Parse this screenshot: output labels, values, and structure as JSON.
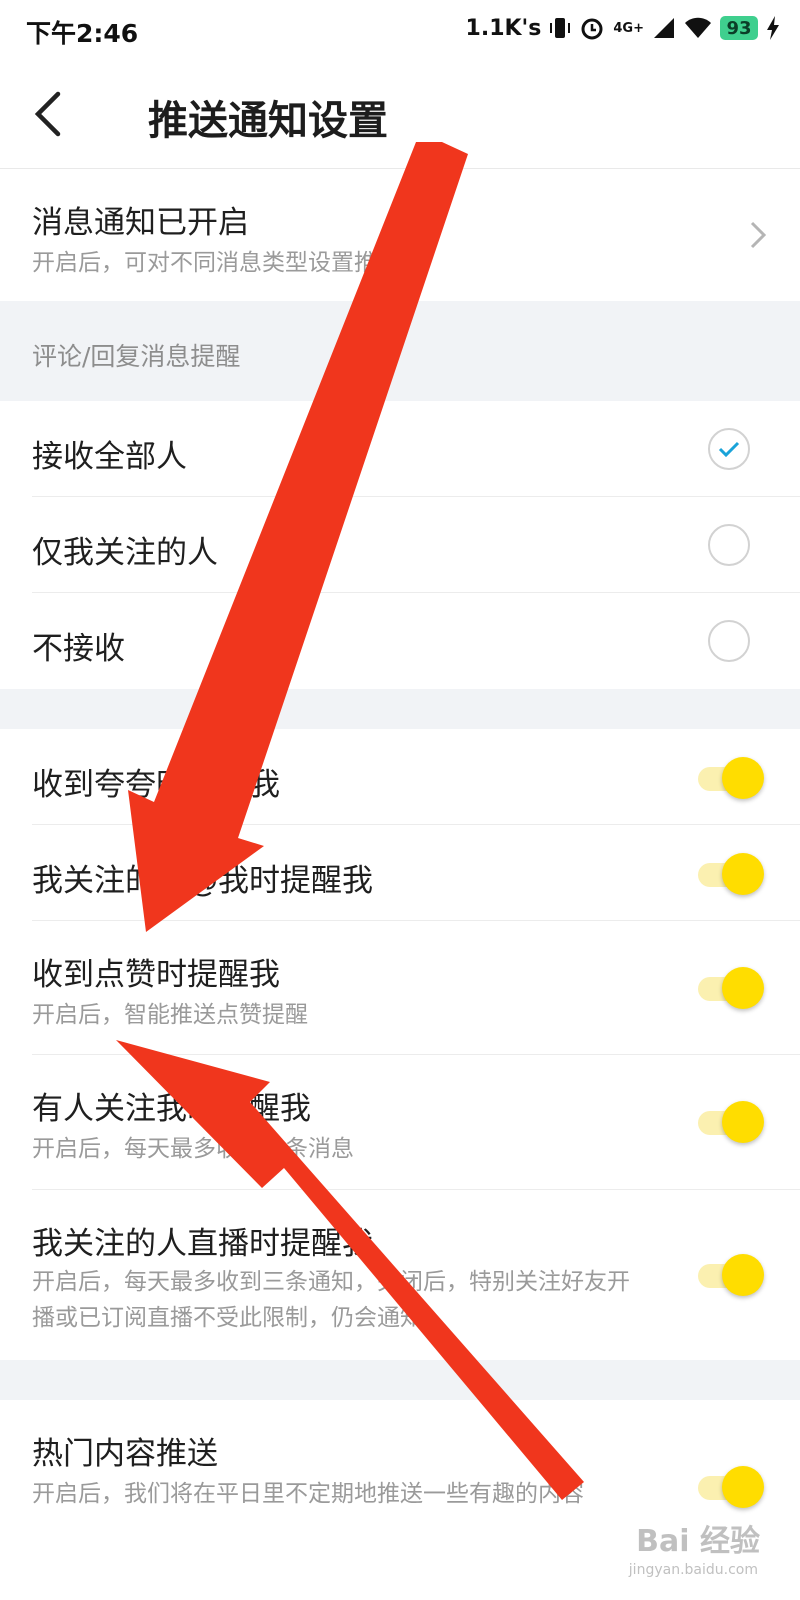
{
  "status_bar": {
    "time": "下午2:46",
    "net_speed": "1.1K's",
    "network": "4G+",
    "battery": "93",
    "icons": [
      "vibrate-icon",
      "alarm-icon",
      "signal-icon",
      "wifi-icon",
      "battery-icon",
      "charging-icon"
    ]
  },
  "header": {
    "title": "推送通知设置",
    "back_icon": "back-arrow-icon"
  },
  "notify_row": {
    "title": "消息通知已开启",
    "desc": "开启后，可对不同消息类型设置推送"
  },
  "comment_section": {
    "label": "评论/回复消息提醒",
    "options": [
      {
        "label": "接收全部人",
        "checked": true
      },
      {
        "label": "仅我关注的人",
        "checked": false
      },
      {
        "label": "不接收",
        "checked": false
      }
    ]
  },
  "toggle_rows": [
    {
      "title": "收到夸夸时提醒我",
      "desc": "",
      "on": true
    },
    {
      "title": "我关注的人@我时提醒我",
      "desc": "",
      "on": true
    },
    {
      "title": "收到点赞时提醒我",
      "desc": "开启后，智能推送点赞提醒",
      "on": true
    },
    {
      "title": "有人关注我时提醒我",
      "desc": "开启后，每天最多收到三条消息",
      "on": true
    },
    {
      "title": "我关注的人直播时提醒我",
      "desc": "开启后，每天最多收到三条通知，关闭后，特别关注好友开播或已订阅直播不受此限制，仍会通知",
      "on": true
    }
  ],
  "hot_row": {
    "title": "热门内容推送",
    "desc": "开启后，我们将在平日里不定期地推送一些有趣的内容",
    "on": true
  },
  "watermark": {
    "text": "Bai 经验",
    "sub": "jingyan.baidu.com"
  },
  "colors": {
    "toggle_on": "#ffdd00",
    "check": "#1aa3d9",
    "arrow": "#f0361d",
    "section_bg": "#f1f3f6"
  }
}
